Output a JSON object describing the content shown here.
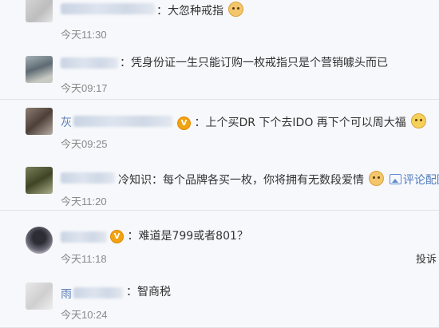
{
  "comments": [
    {
      "name_prefix": "",
      "text": "：大忽种戒指",
      "time": "今天11:30"
    },
    {
      "name_prefix": "",
      "text": "：凭身份证一生只能订购一枚戒指只是个营销噱头而已",
      "time": "今天09:17"
    },
    {
      "name_prefix": "灰",
      "text": "：上个买DR 下个去IDO 再下个可以周大福",
      "time": "今天09:25"
    },
    {
      "name_prefix": "",
      "text": "冷知识：每个品牌各买一枚，你将拥有无数段爱情",
      "link": "评论配图",
      "time": "今天11:20"
    },
    {
      "name_prefix": "",
      "text": "：难道是799或者801？",
      "time": "今天11:18",
      "action": "投诉"
    },
    {
      "name_prefix": "雨",
      "text": "：智商税",
      "time": "今天10:24"
    }
  ],
  "icons": {
    "emoji": "doge-emoji-icon",
    "laugh_cry": "laugh-cry-emoji-icon",
    "verified": "verified-v-badge-icon",
    "picture": "picture-icon"
  },
  "colors": {
    "link": "#4f7bbd",
    "badge": "#f2a311",
    "time": "#888888",
    "background": "#f7f8fb"
  }
}
